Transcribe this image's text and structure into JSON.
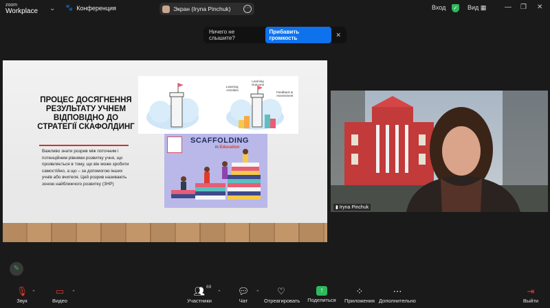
{
  "app": {
    "logo_line1": "zoom",
    "logo_line2": "Workplace"
  },
  "topbar": {
    "meeting_label": "Конференция",
    "screen_share_label": "Экран (Iryna Pinchuk)",
    "signin_label": "Вход",
    "view_label": "Вид"
  },
  "toast": {
    "message": "Ничего не слышите?",
    "button": "Прибавить громкость"
  },
  "slide": {
    "title": "ПРОЦЕС ДОСЯГНЕННЯ РЕЗУЛЬТАТУ УЧНЕМ ВІДПОВІДНО ДО СТРАТЕГІЇ СКАФОЛДИНГ",
    "body": "Важливо знати розрив між поточним і потенційним рівнями розвитку учня, що проявляється в тому, що він може зробити самостійно, а що – за допомогою інших учнів або вчителя. Цей розрив називають зоною найближчого розвитку (ЗНР)",
    "img_labels": [
      "Learning Activities",
      "Learning Outcome",
      "Feedback & Assessment"
    ],
    "scaffolding_title": "SCAFFOLDING",
    "scaffolding_sub_in": "in",
    "scaffolding_sub_edu": "Education"
  },
  "video": {
    "participant_name": "Iryna Pinchuk"
  },
  "toolbar": {
    "audio": "Звук",
    "video": "Видео",
    "participants": "Участники",
    "participants_count": "69",
    "chat": "Чат",
    "react": "Отреагировать",
    "share": "Поделиться",
    "apps": "Приложения",
    "more": "Дополнительно",
    "leave": "Выйти"
  },
  "colors": {
    "accent": "#0e72ed",
    "share_green": "#2eb85c",
    "mute_red": "#e03a2a"
  }
}
